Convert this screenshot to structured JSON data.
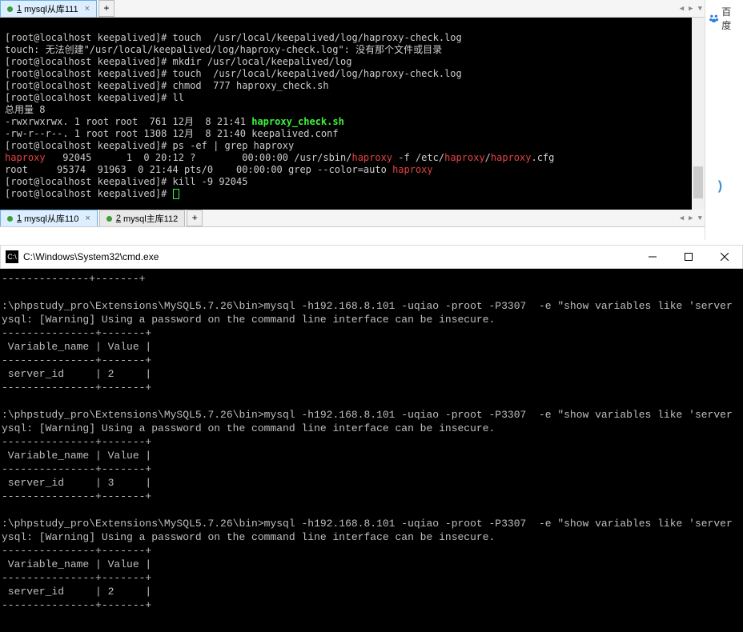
{
  "tabbar1": {
    "tabs": [
      {
        "num": "1",
        "label": "mysql从库111",
        "close": "×"
      }
    ],
    "add": "+"
  },
  "linux_terminal": {
    "l1_prompt": "[root@localhost keepalived]# ",
    "l1_cmd": "touch  /usr/local/keepalived/log/haproxy-check.log",
    "l2": "touch: 无法创建\"/usr/local/keepalived/log/haproxy-check.log\": 没有那个文件或目录",
    "l3_prompt": "[root@localhost keepalived]# ",
    "l3_cmd": "mkdir /usr/local/keepalived/log",
    "l4_prompt": "[root@localhost keepalived]# ",
    "l4_cmd": "touch  /usr/local/keepalived/log/haproxy-check.log",
    "l5_prompt": "[root@localhost keepalived]# ",
    "l5_cmd": "chmod  777 haproxy_check.sh",
    "l6_prompt": "[root@localhost keepalived]# ",
    "l6_cmd": "ll",
    "l7": "总用量 8",
    "l8a": "-rwxrwxrwx. 1 root root  761 12月  8 21:41 ",
    "l8b": "haproxy_check.sh",
    "l9": "-rw-r--r--. 1 root root 1308 12月  8 21:40 keepalived.conf",
    "l10_prompt": "[root@localhost keepalived]# ",
    "l10_cmd": "ps -ef | grep haproxy",
    "l11a": "haproxy",
    "l11b": "   92045      1  0 20:12 ?        00:00:00 /usr/sbin/",
    "l11c": "haproxy",
    "l11d": " -f /etc/",
    "l11e": "haproxy",
    "l11f": "/",
    "l11g": "haproxy",
    "l11h": ".cfg",
    "l12a": "root     95374  91963  0 21:44 pts/0    00:00:00 grep --color=auto ",
    "l12b": "haproxy",
    "l13_prompt": "[root@localhost keepalived]# ",
    "l13_cmd": "kill -9 92045",
    "l14_prompt": "[root@localhost keepalived]# "
  },
  "tabbar2": {
    "tabs": [
      {
        "num": "1",
        "label": "mysql从库110",
        "close": "×"
      },
      {
        "num": "2",
        "label": "mysql主库112",
        "close": ""
      }
    ],
    "add": "+"
  },
  "sidebar": {
    "baidu": "百度",
    "paren": ")"
  },
  "cmd_title": "C:\\Windows\\System32\\cmd.exe",
  "cmd_icon": "C:\\",
  "cmd": {
    "hr": "--------------+-------+",
    "prompt": ":\\phpstudy_pro\\Extensions\\MySQL5.7.26\\bin>mysql -h192.168.8.101 -uqiao -proot -P3307  -e \"show variables like 'server",
    "warn": "ysql: [Warning] Using a password on the command line interface can be insecure.",
    "hdr_hr": "---------------+-------+",
    "hdr": " Variable_name | Value |",
    "row2": " server_id     | 2     |",
    "row3": " server_id     | 3     |"
  }
}
